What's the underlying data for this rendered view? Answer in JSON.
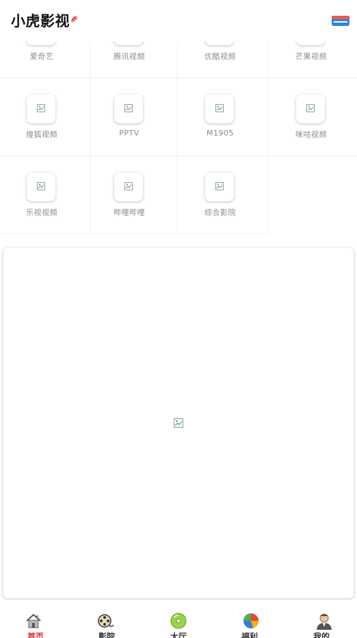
{
  "header": {
    "title": "小虎影视"
  },
  "platforms": [
    {
      "label": "爱奇艺"
    },
    {
      "label": "腾讯视频"
    },
    {
      "label": "优酷视频"
    },
    {
      "label": "芒果视频"
    },
    {
      "label": "搜狐视频"
    },
    {
      "label": "PPTV"
    },
    {
      "label": "M1905"
    },
    {
      "label": "咪咕视频"
    },
    {
      "label": "乐视视频"
    },
    {
      "label": "哔哩哔哩"
    },
    {
      "label": "综合影院"
    }
  ],
  "tabbar": {
    "items": [
      {
        "label": "首页",
        "icon": "home-icon",
        "active": true
      },
      {
        "label": "影院",
        "icon": "film-reel-icon",
        "active": false
      },
      {
        "label": "大厅",
        "icon": "disc-icon",
        "active": false
      },
      {
        "label": "福利",
        "icon": "pie-chart-icon",
        "active": false
      },
      {
        "label": "我的",
        "icon": "user-icon",
        "active": false
      }
    ]
  },
  "colors": {
    "accent": "#e8231f",
    "menu": "#2e86e6"
  }
}
